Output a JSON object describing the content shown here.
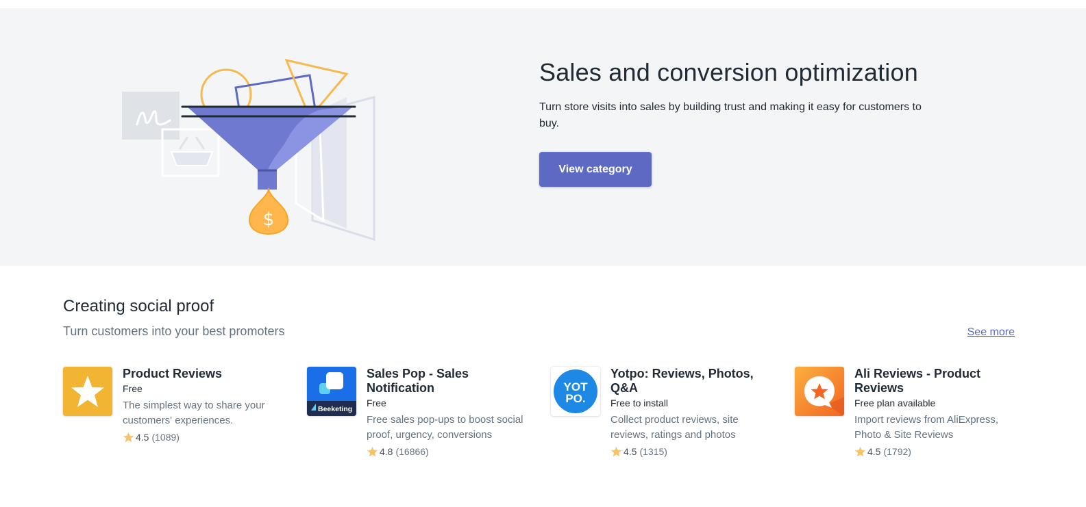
{
  "hero": {
    "title": "Sales and conversion optimization",
    "description": "Turn store visits into sales by building trust and making it easy for customers to buy.",
    "button_label": "View category",
    "illustration_icon": "sales-funnel-illustration",
    "accent_color": "#5c6ac4"
  },
  "section": {
    "title": "Creating social proof",
    "subtitle": "Turn customers into your best promoters",
    "see_more_label": "See more"
  },
  "apps": [
    {
      "name": "Product Reviews",
      "price": "Free",
      "description": "The simplest way to share your customers' experiences.",
      "rating": "4.5",
      "reviews": "(1089)",
      "icon": "star-icon",
      "icon_color": "#f1b433"
    },
    {
      "name": "Sales Pop - Sales Notification",
      "price": "Free",
      "description": "Free sales pop-ups to boost social proof, urgency, conversions",
      "rating": "4.8",
      "reviews": "(16866)",
      "icon": "beeketing-icon",
      "icon_text": "Beeketing",
      "icon_color": "#1a6fe8"
    },
    {
      "name": "Yotpo: Reviews, Photos, Q&A",
      "price": "Free to install",
      "description": "Collect product reviews, site reviews, ratings and photos",
      "rating": "4.5",
      "reviews": "(1315)",
      "icon": "yotpo-icon",
      "icon_text_line1": "YOT",
      "icon_text_line2": "PO.",
      "icon_color": "#1e88e5"
    },
    {
      "name": "Ali Reviews - Product Reviews",
      "price": "Free plan available",
      "description": "Import reviews from AliExpress, Photo & Site Reviews",
      "rating": "4.5",
      "reviews": "(1792)",
      "icon": "ali-reviews-icon",
      "icon_color": "#f7931e"
    }
  ]
}
